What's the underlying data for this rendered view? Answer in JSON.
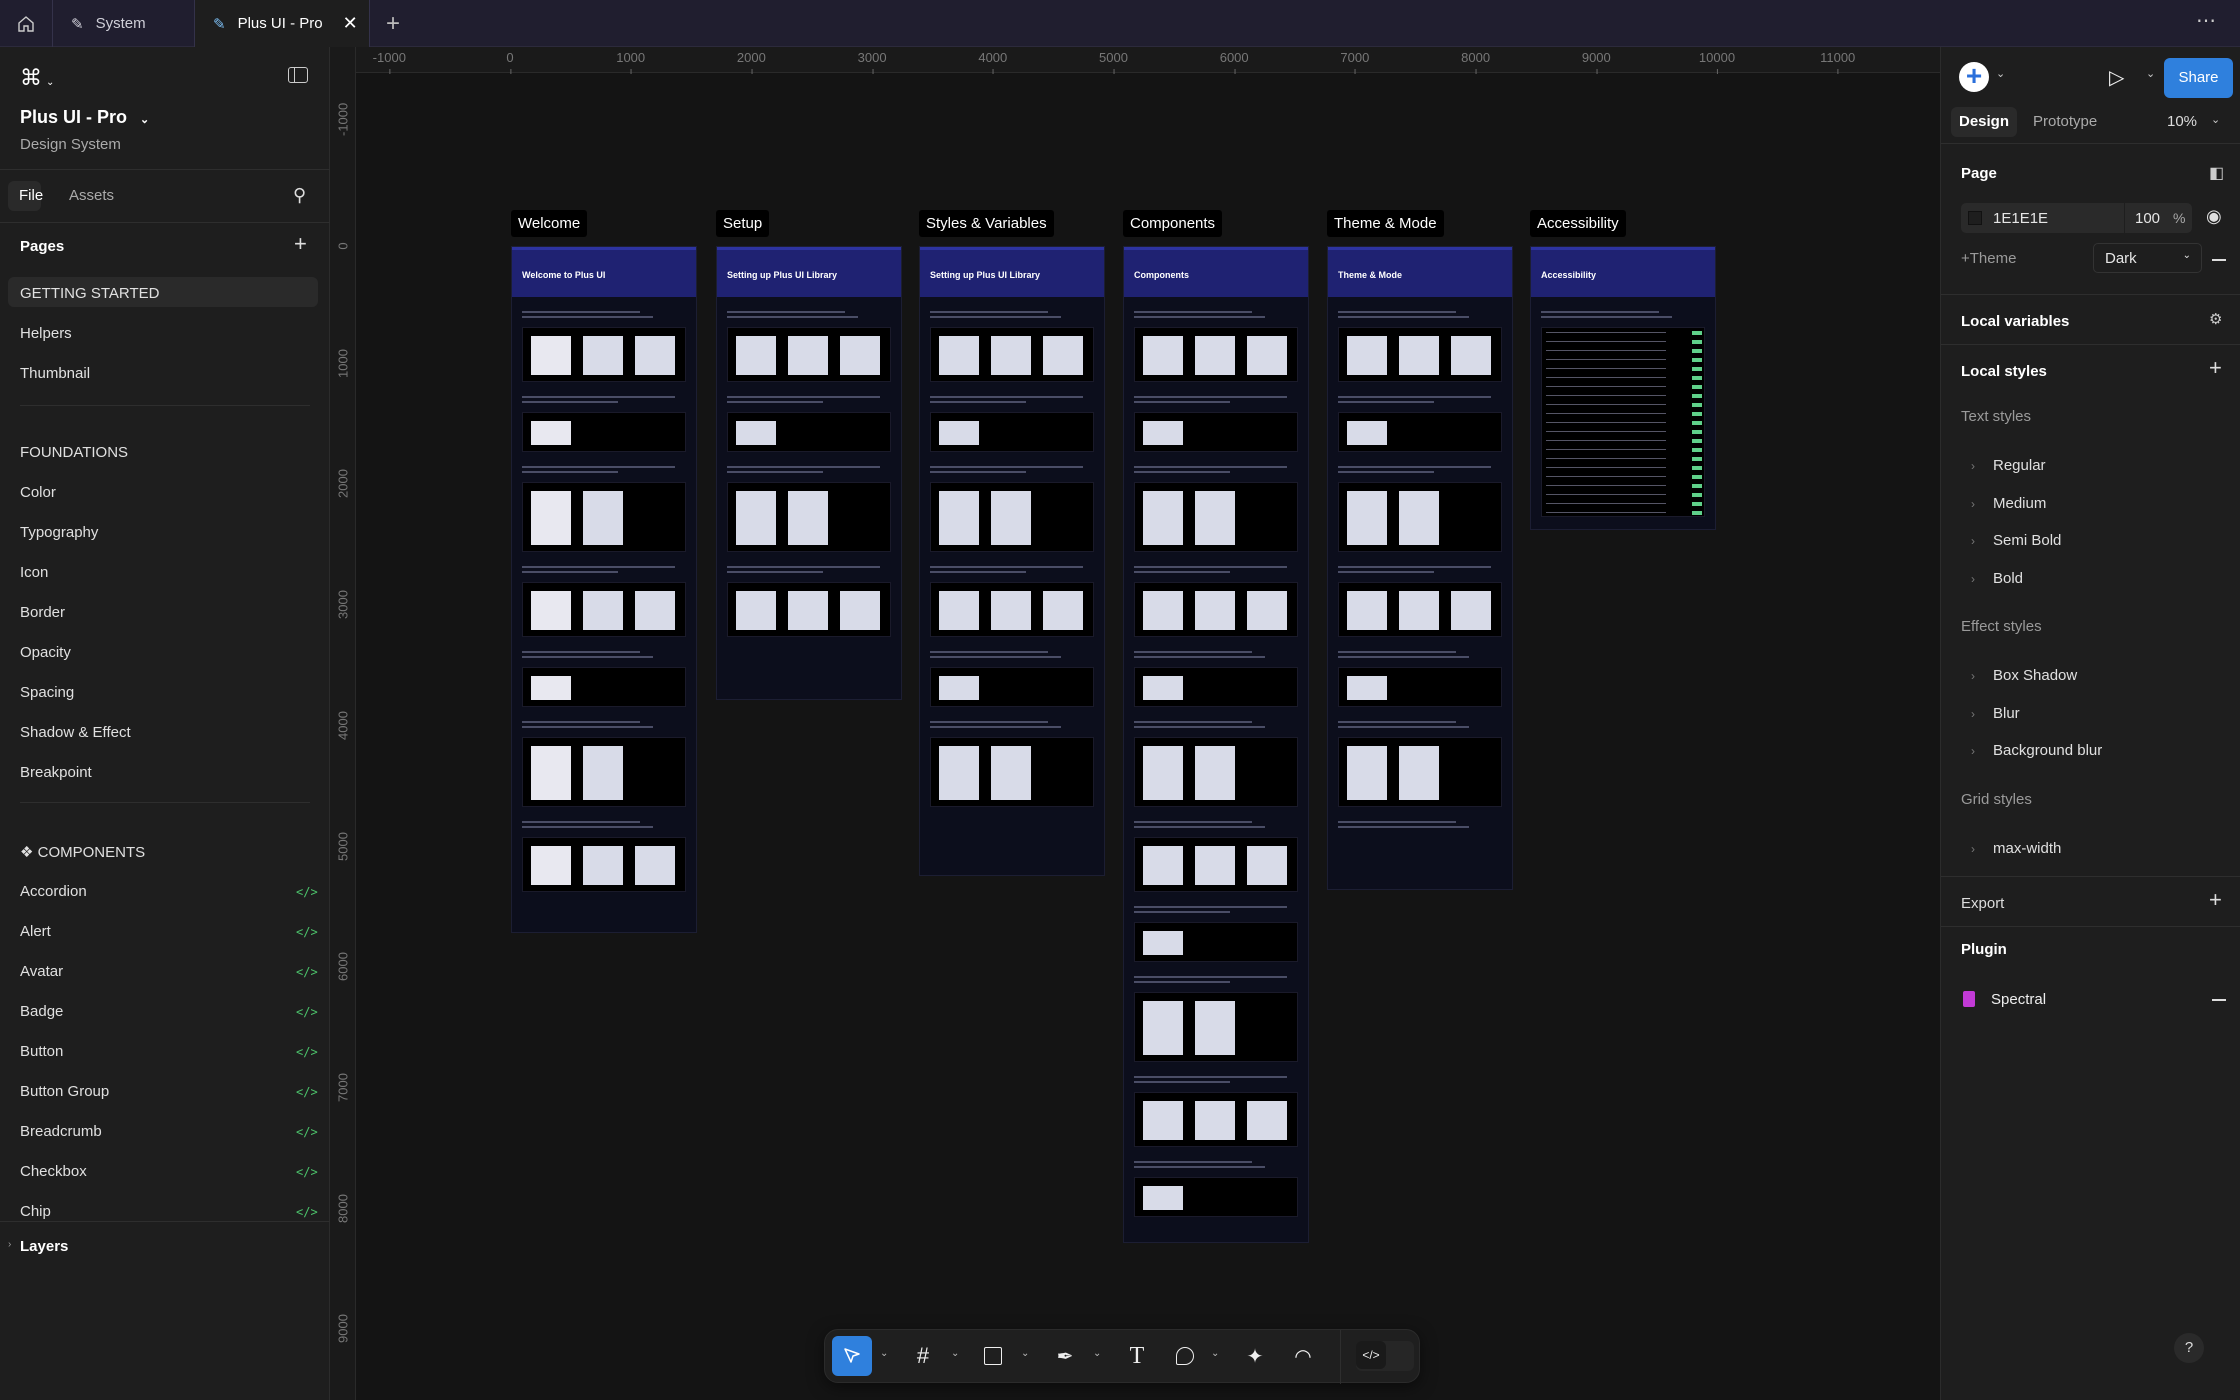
{
  "tabs": [
    {
      "label": "System"
    },
    {
      "label": "Plus UI - Pro"
    }
  ],
  "file": {
    "name": "Plus UI - Pro",
    "subtitle": "Design System"
  },
  "left_tabs": {
    "file": "File",
    "assets": "Assets"
  },
  "pages": {
    "title": "Pages",
    "items": [
      "GETTING STARTED",
      "Helpers",
      "Thumbnail",
      "FOUNDATIONS",
      "Color",
      "Typography",
      "Icon",
      "Border",
      "Opacity",
      "Spacing",
      "Shadow & Effect",
      "Breakpoint",
      "❖ COMPONENTS",
      "Accordion",
      "Alert",
      "Avatar",
      "Badge",
      "Button",
      "Button Group",
      "Breadcrumb",
      "Checkbox",
      "Chip"
    ]
  },
  "layers_label": "Layers",
  "ruler": {
    "h": [
      "-1000",
      "0",
      "1000",
      "2000",
      "3000",
      "4000",
      "5000",
      "6000",
      "7000",
      "8000",
      "9000",
      "10000",
      "11000"
    ],
    "v": [
      "-1000",
      "0",
      "1000",
      "2000",
      "3000",
      "4000",
      "5000",
      "6000",
      "7000",
      "8000",
      "9000"
    ]
  },
  "frames": [
    {
      "label": "Welcome",
      "title": "Welcome to Plus UI"
    },
    {
      "label": "Setup",
      "title": "Setting up Plus UI Library"
    },
    {
      "label": "Styles & Variables",
      "title": "Setting up Plus UI Library"
    },
    {
      "label": "Components",
      "title": "Components"
    },
    {
      "label": "Theme & Mode",
      "title": "Theme & Mode"
    },
    {
      "label": "Accessibility",
      "title": "Accessibility"
    }
  ],
  "right": {
    "share": "Share",
    "tab_design": "Design",
    "tab_prototype": "Prototype",
    "zoom": "10%",
    "page_title": "Page",
    "page_color": "1E1E1E",
    "page_opacity": "100",
    "percent": "%",
    "theme_label": "+Theme",
    "theme_value": "Dark",
    "local_variables": "Local variables",
    "local_styles": "Local styles",
    "text_styles": "Text styles",
    "text_items": [
      "Regular",
      "Medium",
      "Semi Bold",
      "Bold"
    ],
    "effect_styles": "Effect styles",
    "effect_items": [
      "Box Shadow",
      "Blur",
      "Background blur"
    ],
    "grid_styles": "Grid styles",
    "grid_items": [
      "max-width"
    ],
    "export": "Export",
    "plugin": "Plugin",
    "plugin_item": "Spectral",
    "help": "?"
  },
  "colors": {
    "accent": "#2f80dd",
    "canvas": "#141414",
    "panel": "#1e1e1e",
    "code_icon": "#4cc36b"
  }
}
